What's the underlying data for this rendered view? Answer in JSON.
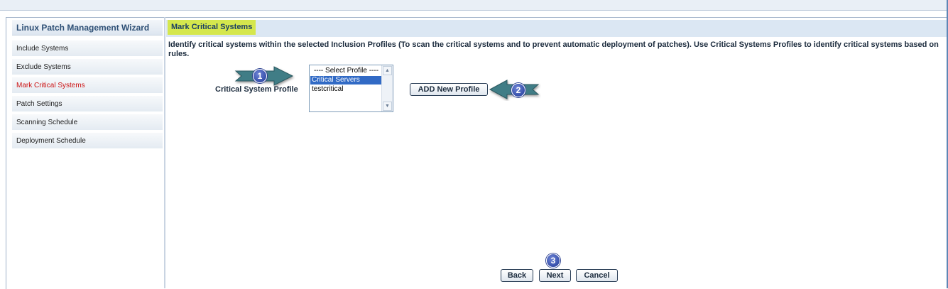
{
  "sidebar": {
    "title": "Linux Patch Management Wizard",
    "items": [
      {
        "label": "Include Systems"
      },
      {
        "label": "Exclude Systems"
      },
      {
        "label": "Mark Critical Systems"
      },
      {
        "label": "Patch Settings"
      },
      {
        "label": "Scanning Schedule"
      },
      {
        "label": "Deployment Schedule"
      }
    ],
    "active_index": 2
  },
  "main": {
    "section_title": "Mark Critical Systems",
    "description": "Identify critical systems within the selected Inclusion Profiles (To scan the critical systems and to prevent automatic deployment of patches). Use Critical Systems Profiles to identify critical systems based on rules.",
    "field_label": "Critical System Profile",
    "profile_list": {
      "options": [
        "---- Select Profile ----",
        "Critical Servers",
        "testcritical"
      ],
      "selected": "Critical Servers"
    },
    "add_profile_label": "ADD New Profile"
  },
  "footer": {
    "back_label": "Back",
    "next_label": "Next",
    "cancel_label": "Cancel"
  },
  "annotations": {
    "step1": "1",
    "step2": "2",
    "step3": "3"
  },
  "colors": {
    "title_highlight": "#d5e74d",
    "active_nav": "#cc1111",
    "header_band": "#dbe7f3",
    "badge": "#2a3f8f",
    "callout_arrow": "#3f7d86"
  }
}
